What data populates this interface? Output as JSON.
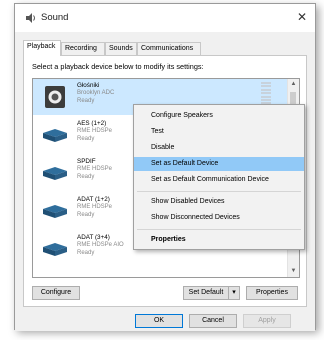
{
  "window": {
    "title": "Sound",
    "close": "✕"
  },
  "tabs": [
    {
      "label": "Playback"
    },
    {
      "label": "Recording"
    },
    {
      "label": "Sounds"
    },
    {
      "label": "Communications"
    }
  ],
  "instruction": "Select a playback device below to modify its settings:",
  "devices": [
    {
      "name": "Głośniki",
      "sub": "Brooklyn ADC",
      "status": "Ready"
    },
    {
      "name": "AES (1+2)",
      "sub": "RME HDSPe",
      "status": "Ready"
    },
    {
      "name": "SPDIF",
      "sub": "RME HDSPe",
      "status": "Ready"
    },
    {
      "name": "ADAT (1+2)",
      "sub": "RME HDSPe",
      "status": "Ready"
    },
    {
      "name": "ADAT (3+4)",
      "sub": "RME HDSPe AIO",
      "status": "Ready"
    }
  ],
  "buttons": {
    "configure": "Configure",
    "set_default": "Set Default",
    "set_default_arrow": "▾",
    "properties": "Properties",
    "ok": "OK",
    "cancel": "Cancel",
    "apply": "Apply"
  },
  "scrollbar": {
    "up": "▲",
    "down": "▼"
  },
  "context_menu": {
    "items": [
      {
        "label": "Configure Speakers"
      },
      {
        "label": "Test"
      },
      {
        "label": "Disable"
      },
      {
        "label": "Set as Default Device"
      },
      {
        "label": "Set as Default Communication Device"
      },
      {
        "label": "Show Disabled Devices"
      },
      {
        "label": "Show Disconnected Devices"
      },
      {
        "label": "Properties"
      }
    ]
  },
  "colors": {
    "selection": "#cce8ff",
    "menu_highlight": "#91c9f7",
    "accent": "#0078d7"
  }
}
